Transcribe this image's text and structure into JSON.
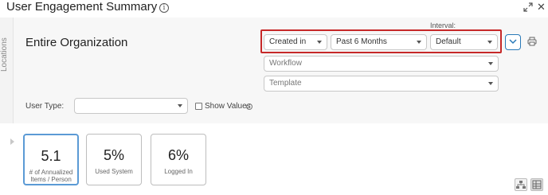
{
  "header": {
    "title": "User Engagement Summary",
    "info_icon": "info-icon",
    "expand_icon": "expand-icon",
    "close_glyph": "✕"
  },
  "side_tab": {
    "label": "Locations"
  },
  "organization": {
    "title": "Entire Organization"
  },
  "filters": {
    "interval_label": "Interval:",
    "date_field": "Created in",
    "date_range": "Past 6 Months",
    "interval": "Default",
    "workflow_placeholder": "Workflow",
    "template_placeholder": "Template",
    "user_type_label": "User Type:",
    "user_type_value": "",
    "show_values_label": "Show Values",
    "show_values_checked": false,
    "highlight_color": "#c62828"
  },
  "kpis": [
    {
      "value": "5.1",
      "label": "# of Annualized Items / Person",
      "active": true
    },
    {
      "value": "5%",
      "label": "Used System",
      "active": false
    },
    {
      "value": "6%",
      "label": "Logged In",
      "active": false
    }
  ],
  "colors": {
    "accent": "#2979b8",
    "active_card_border": "#5b9ad5"
  }
}
